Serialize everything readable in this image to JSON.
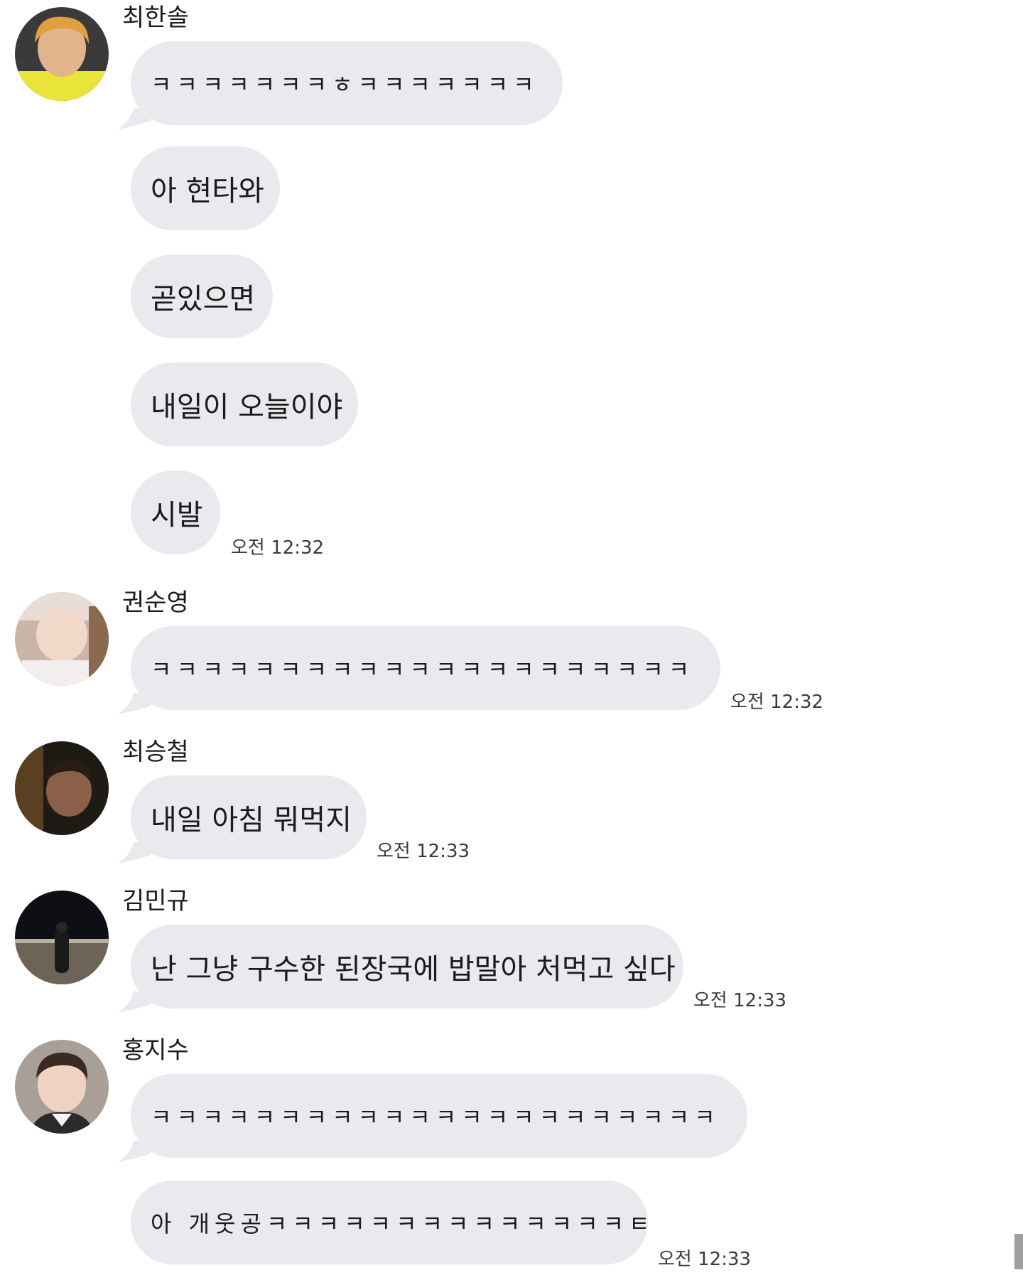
{
  "groups": [
    {
      "sender": "최한솔",
      "avatar": "avatar-photo",
      "messages": [
        "ㅋㅋㅋㅋㅋㅋㅋㅎㅋㅋㅋㅋㅋㅋㅋ",
        "아 현타와",
        "곧있으면",
        "내일이 오늘이야",
        "시발"
      ],
      "time": "오전 12:32"
    },
    {
      "sender": "권순영",
      "avatar": "avatar-photo",
      "messages": [
        "ㅋㅋㅋㅋㅋㅋㅋㅋㅋㅋㅋㅋㅋㅋㅋㅋㅋㅋㅋㅋㅋ"
      ],
      "time": "오전 12:32"
    },
    {
      "sender": "최승철",
      "avatar": "avatar-photo",
      "messages": [
        "내일 아침 뭐먹지"
      ],
      "time": "오전 12:33"
    },
    {
      "sender": "김민규",
      "avatar": "avatar-photo",
      "messages": [
        "난 그냥 구수한 된장국에 밥말아 처먹고 싶다"
      ],
      "time": "오전 12:33"
    },
    {
      "sender": "홍지수",
      "avatar": "avatar-photo",
      "messages": [
        "ㅋㅋㅋㅋㅋㅋㅋㅋㅋㅋㅋㅋㅋㅋㅋㅋㅋㅋㅋㅋㅋㅋ",
        "아 개웃공ㅋㅋㅋㅋㅋㅋㅋㅋㅋㅋㅋㅋㅋㅋㅌ"
      ],
      "time": "오전 12:33"
    }
  ],
  "colors": {
    "bubble": "#e9e9ee",
    "text": "#1b1b1b",
    "time": "#3a3a3a",
    "background": "#ffffff"
  }
}
